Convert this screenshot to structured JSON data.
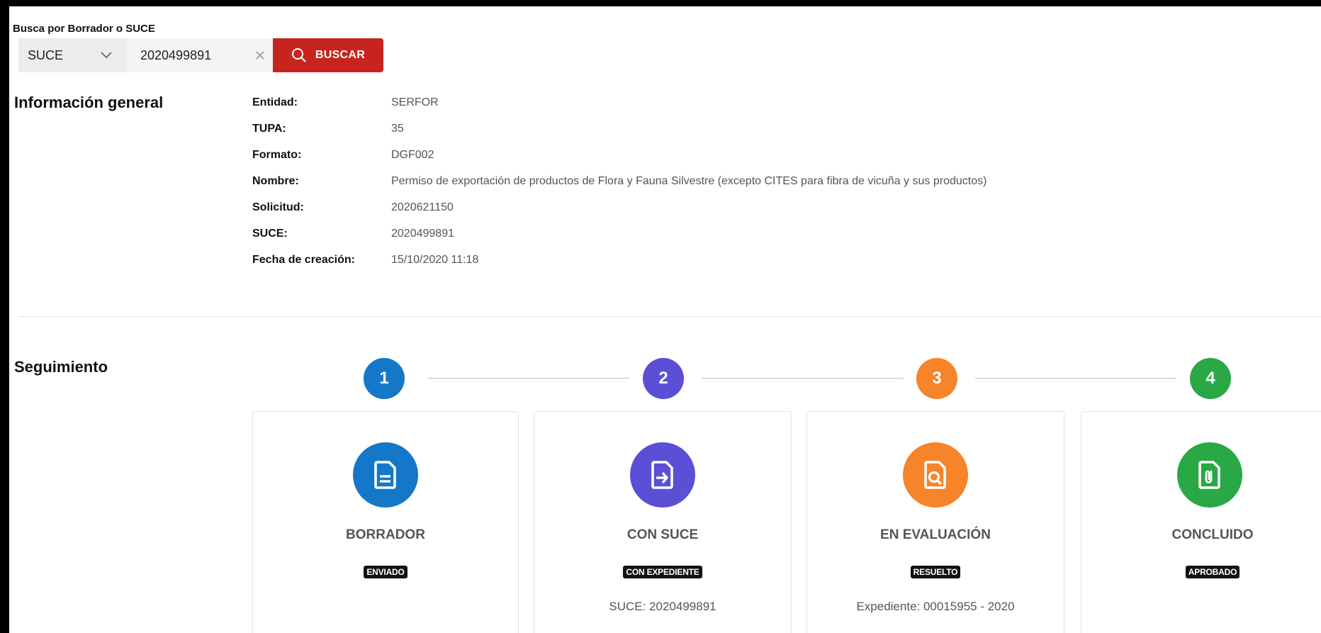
{
  "search": {
    "label": "Busca por Borrador o SUCE",
    "type_selected": "SUCE",
    "value": "2020499891",
    "button_label": "BUSCAR"
  },
  "general_info": {
    "title": "Información general",
    "rows": [
      {
        "key": "Entidad:",
        "value": "SERFOR"
      },
      {
        "key": "TUPA:",
        "value": "35"
      },
      {
        "key": "Formato:",
        "value": "DGF002"
      },
      {
        "key": "Nombre:",
        "value": "Permiso de exportación de productos de Flora y Fauna Silvestre (excepto CITES para fibra de vicuña y sus productos)"
      },
      {
        "key": "Solicitud:",
        "value": "2020621150"
      },
      {
        "key": "SUCE:",
        "value": "2020499891"
      },
      {
        "key": "Fecha de creación:",
        "value": "15/10/2020 11:18"
      }
    ]
  },
  "tracking": {
    "title": "Seguimiento",
    "steps": [
      {
        "number": "1",
        "title": "BORRADOR",
        "badge": "ENVIADO",
        "detail": "",
        "color": "#1577c8",
        "icon": "document-icon"
      },
      {
        "number": "2",
        "title": "CON SUCE",
        "badge": "CON EXPEDIENTE",
        "detail": "SUCE: 2020499891",
        "color": "#5b4fd6",
        "icon": "document-arrow-icon"
      },
      {
        "number": "3",
        "title": "EN EVALUACIÓN",
        "badge": "RESUELTO",
        "detail": "Expediente: 00015955 - 2020",
        "color": "#f5842a",
        "icon": "document-search-icon"
      },
      {
        "number": "4",
        "title": "CONCLUIDO",
        "badge": "APROBADO",
        "detail": "",
        "color": "#29a845",
        "icon": "document-clip-icon"
      }
    ]
  }
}
